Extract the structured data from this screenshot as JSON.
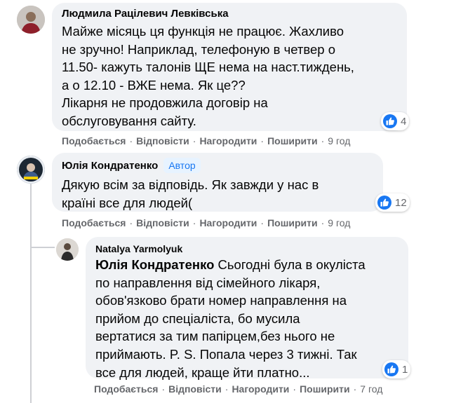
{
  "comments": [
    {
      "author": "Людмила Рацілевич Левківська",
      "text": "Майже місяць ця функція не працює. Жахливо\nне зручно! Наприклад, телефоную в четвер о\n11.50- кажуть талонів ЩЕ нема на наст.тиждень,\nа о 12.10 - ВЖЕ нема. Як це??\nЛікарня не продовжила договір на\nобслуговування сайту.",
      "reaction_count": "4",
      "actions": {
        "like": "Подобається",
        "reply": "Відповісти",
        "award": "Нагородити",
        "share": "Поширити",
        "time": "9 год"
      }
    },
    {
      "author": "Юлія Кондратенко",
      "badge": "Автор",
      "text": "Дякую всім за відповідь. Як завжди у нас в\nкраїні все для людей(",
      "reaction_count": "12",
      "actions": {
        "like": "Подобається",
        "reply": "Відповісти",
        "award": "Нагородити",
        "share": "Поширити",
        "time": "9 год"
      }
    },
    {
      "author": "Natalya Yarmolyuk",
      "mention": "Юлія Кондратенко",
      "text": " Сьогодні була в окуліста\nпо направлення від сімейного лікаря,\nобов'язково брати номер направлення на\nприйом до спеціаліста, бо мусила\nвертатися за тим папірцем,без нього не\nприймають. P. S. Попала через 3 тижні. Так\nвсе для людей, краще йти платно...",
      "reaction_count": "1",
      "actions": {
        "like": "Подобається",
        "reply": "Відповісти",
        "award": "Нагородити",
        "share": "Поширити",
        "time": "7 год"
      }
    }
  ],
  "separator": "·",
  "colors": {
    "bubble": "#f0f2f5",
    "meta": "#65676b",
    "like_blue": "#1877f2",
    "badge_bg": "#e7f3ff"
  },
  "icons": {
    "reaction": "like-icon"
  }
}
